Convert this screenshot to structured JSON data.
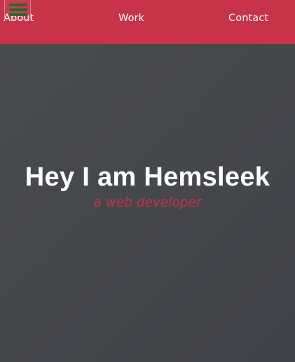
{
  "nav": {
    "menu_icon": "hamburger-menu-icon",
    "links": [
      {
        "label": "About"
      },
      {
        "label": "Work"
      },
      {
        "label": "Contact"
      }
    ]
  },
  "hero": {
    "title": "Hey I am Hemsleek",
    "subtitle": "a web developer"
  },
  "colors": {
    "navbar_bg": "#c9334a",
    "hero_bg": "#44474c",
    "accent": "#cb3149",
    "menu_icon": "#1f6f2a",
    "text": "#ffffff"
  }
}
